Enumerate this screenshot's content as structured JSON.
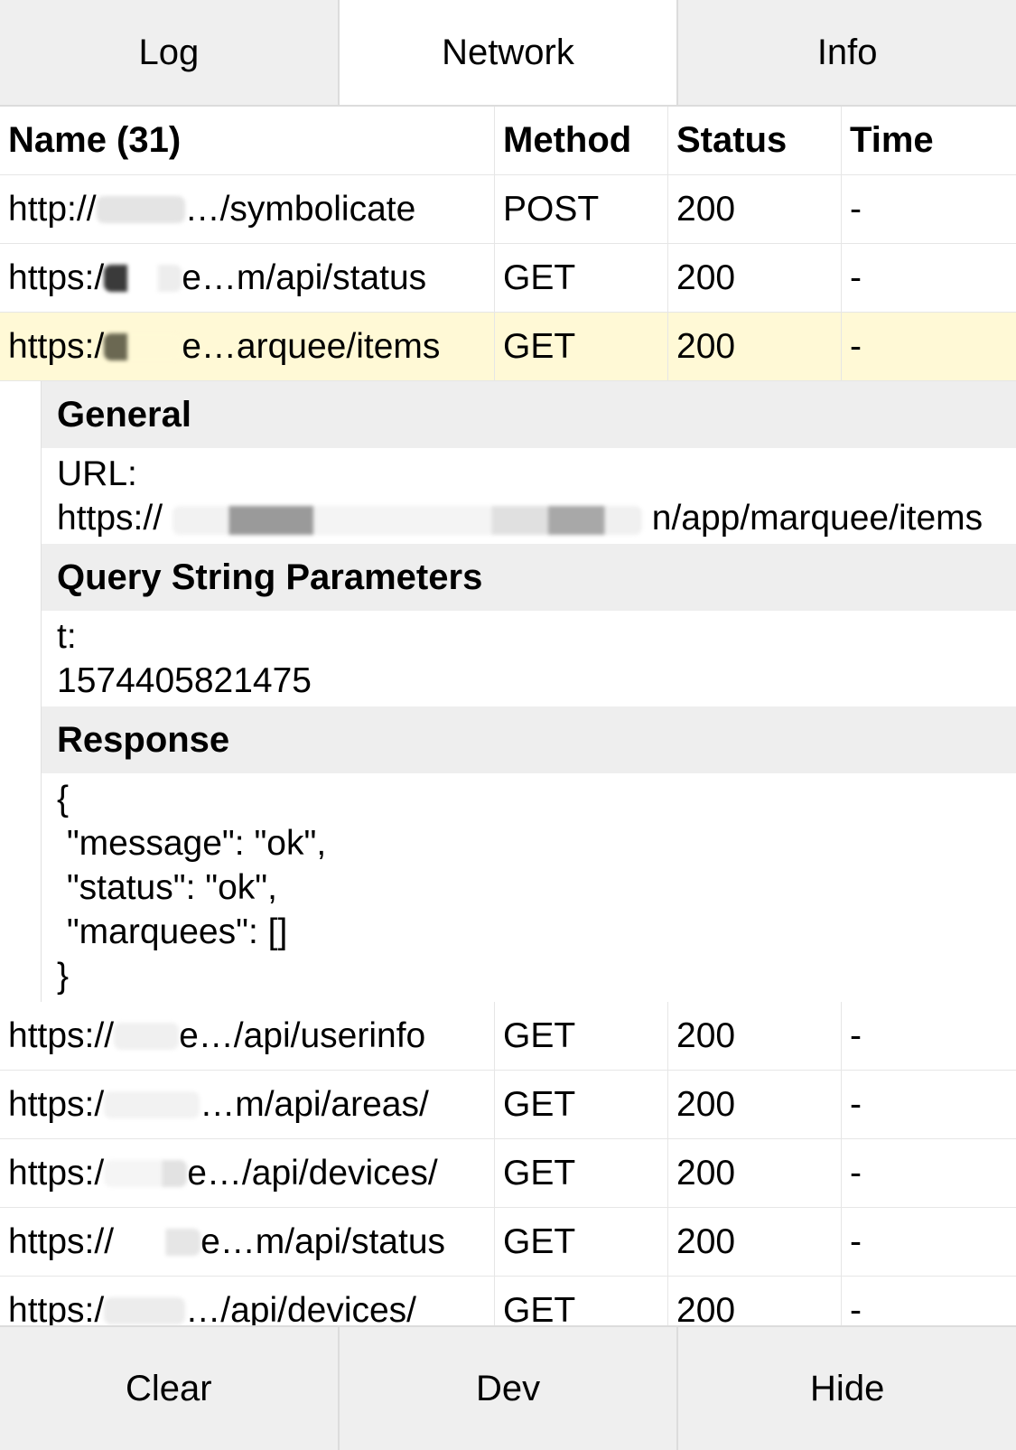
{
  "tabs": [
    {
      "label": "Log"
    },
    {
      "label": "Network"
    },
    {
      "label": "Info"
    }
  ],
  "table": {
    "headers": {
      "name": "Name (31)",
      "method": "Method",
      "status": "Status",
      "time": "Time"
    },
    "rows_before": [
      {
        "name_prefix": "http://",
        "name_suffix": "…/symbolicate",
        "method": "POST",
        "status": "200",
        "time": "-"
      },
      {
        "name_prefix": "https:/",
        "name_suffix": "e…m/api/status",
        "method": "GET",
        "status": "200",
        "time": "-"
      },
      {
        "name_prefix": "https:/",
        "name_suffix": "e…arquee/items",
        "method": "GET",
        "status": "200",
        "time": "-"
      }
    ],
    "rows_after": [
      {
        "name_prefix": "https://",
        "name_suffix": "e…/api/userinfo",
        "method": "GET",
        "status": "200",
        "time": "-"
      },
      {
        "name_prefix": "https:/",
        "name_suffix": "…m/api/areas/",
        "method": "GET",
        "status": "200",
        "time": "-"
      },
      {
        "name_prefix": "https:/",
        "name_suffix": "e…/api/devices/",
        "method": "GET",
        "status": "200",
        "time": "-"
      },
      {
        "name_prefix": "https://",
        "name_suffix": "e…m/api/status",
        "method": "GET",
        "status": "200",
        "time": "-"
      },
      {
        "name_prefix": "https:/",
        "name_suffix": "…/api/devices/",
        "method": "GET",
        "status": "200",
        "time": "-"
      }
    ]
  },
  "detail": {
    "general": {
      "title": "General",
      "url_key": "URL:",
      "url_prefix": "https://",
      "url_suffix": "n/app/marquee/items"
    },
    "query": {
      "title": "Query String Parameters",
      "key": "t:",
      "value": "1574405821475"
    },
    "response": {
      "title": "Response",
      "body": "{\n \"message\": \"ok\",\n \"status\": \"ok\",\n \"marquees\": []\n}"
    }
  },
  "bottom_buttons": [
    {
      "label": "Clear"
    },
    {
      "label": "Dev"
    },
    {
      "label": "Hide"
    }
  ],
  "colors": {
    "selected_row": "#fff9d6",
    "toolbar_bg": "#efefef",
    "section_bg": "#eeeeee"
  }
}
